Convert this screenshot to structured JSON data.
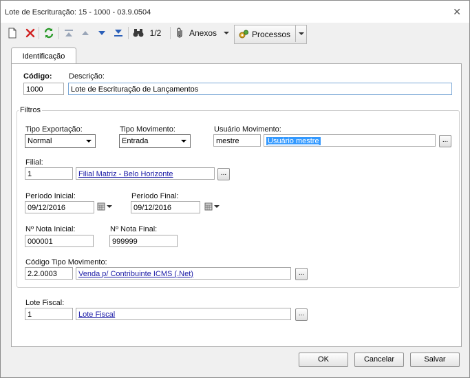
{
  "window": {
    "title": "Lote de Escrituração: 15 - 1000 - 03.9.0504"
  },
  "toolbar": {
    "paging": "1/2",
    "anexos_label": "Anexos",
    "processos_label": "Processos"
  },
  "tabs": [
    {
      "label": "Identificação"
    }
  ],
  "form": {
    "codigo_label": "Código:",
    "codigo_value": "1000",
    "descricao_label": "Descrição:",
    "descricao_value": "Lote de Escrituração de Lançamentos",
    "filtros_label": "Filtros",
    "tipo_exportacao_label": "Tipo Exportação:",
    "tipo_exportacao_value": "Normal",
    "tipo_movimento_label": "Tipo Movimento:",
    "tipo_movimento_value": "Entrada",
    "usuario_movimento_label": "Usuário Movimento:",
    "usuario_code": "mestre",
    "usuario_name": "Usuário mestre",
    "filial_label": "Filial:",
    "filial_code": "1",
    "filial_name": "Filial Matriz - Belo Horizonte",
    "periodo_inicial_label": "Período Inicial:",
    "periodo_inicial_value": "09/12/2016",
    "periodo_final_label": "Período Final:",
    "periodo_final_value": "09/12/2016",
    "nota_inicial_label": "Nº Nota Inicial:",
    "nota_inicial_value": "000001",
    "nota_final_label": "Nº Nota Final:",
    "nota_final_value": "999999",
    "codigo_tipo_mov_label": "Código Tipo Movimento:",
    "codigo_tipo_mov_code": "2.2.0003",
    "codigo_tipo_mov_name": "Venda p/ Contribuinte ICMS (.Net)",
    "lote_fiscal_label": "Lote Fiscal:",
    "lote_fiscal_code": "1",
    "lote_fiscal_name": "Lote Fiscal",
    "ellipsis": "..."
  },
  "buttons": {
    "ok": "OK",
    "cancelar": "Cancelar",
    "salvar": "Salvar"
  },
  "colors": {
    "link": "#1a1aa6",
    "selection": "#3399ff",
    "delete": "#d02020",
    "refresh": "#2a9a2a",
    "nav_arrow": "#2b5fb8"
  }
}
